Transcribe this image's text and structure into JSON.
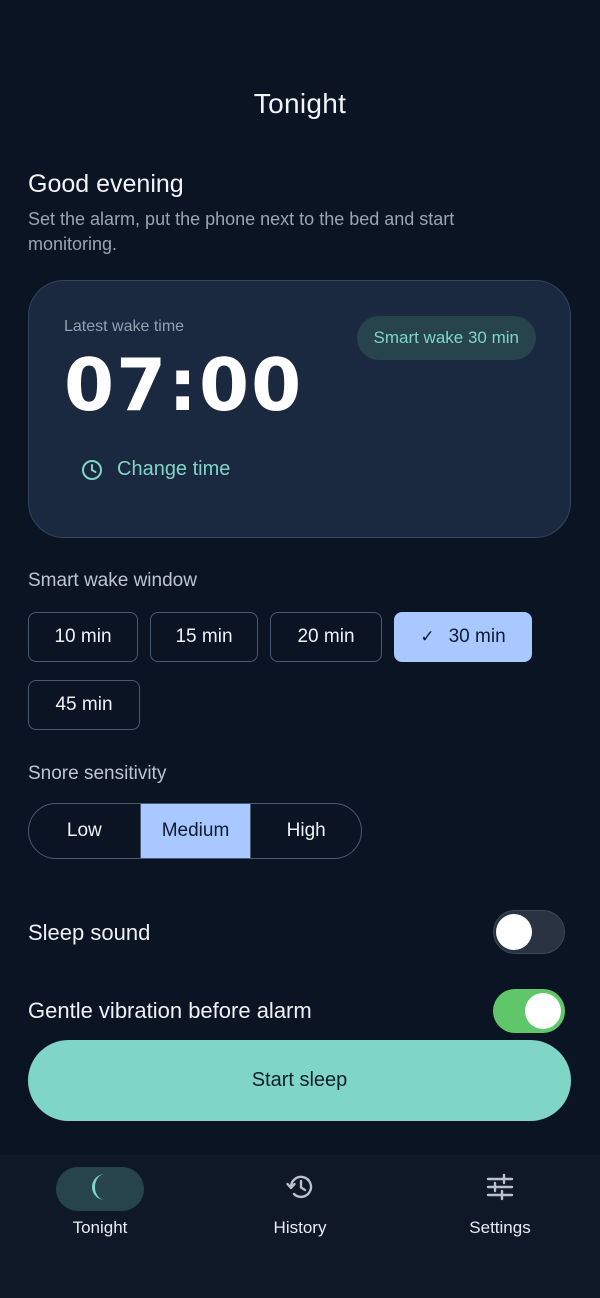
{
  "header": {
    "title": "Tonight"
  },
  "greeting": {
    "title": "Good evening",
    "subtitle": "Set the alarm, put the phone next to the bed and start monitoring."
  },
  "alarm": {
    "label": "Latest wake time",
    "time": "07:00",
    "badge": "Smart wake 30 min",
    "change_label": "Change time"
  },
  "smart_wake": {
    "label": "Smart wake window",
    "options": [
      "10 min",
      "15 min",
      "20 min",
      "30 min",
      "45 min"
    ],
    "selected": "30 min"
  },
  "snore": {
    "label": "Snore sensitivity",
    "options": [
      "Low",
      "Medium",
      "High"
    ],
    "selected": "Medium"
  },
  "toggles": {
    "sleep_sound": {
      "label": "Sleep sound",
      "on": false
    },
    "vibration": {
      "label": "Gentle vibration before alarm",
      "on": true
    }
  },
  "start_button": "Start sleep",
  "nav": {
    "items": [
      {
        "label": "Tonight",
        "icon": "moon-icon",
        "active": true
      },
      {
        "label": "History",
        "icon": "history-icon",
        "active": false
      },
      {
        "label": "Settings",
        "icon": "sliders-icon",
        "active": false
      }
    ]
  },
  "colors": {
    "background": "#0b1422",
    "card": "#1a2840",
    "accent_teal": "#7fd6c7",
    "selected_blue": "#a9c8ff",
    "toggle_on": "#5fc66a"
  }
}
